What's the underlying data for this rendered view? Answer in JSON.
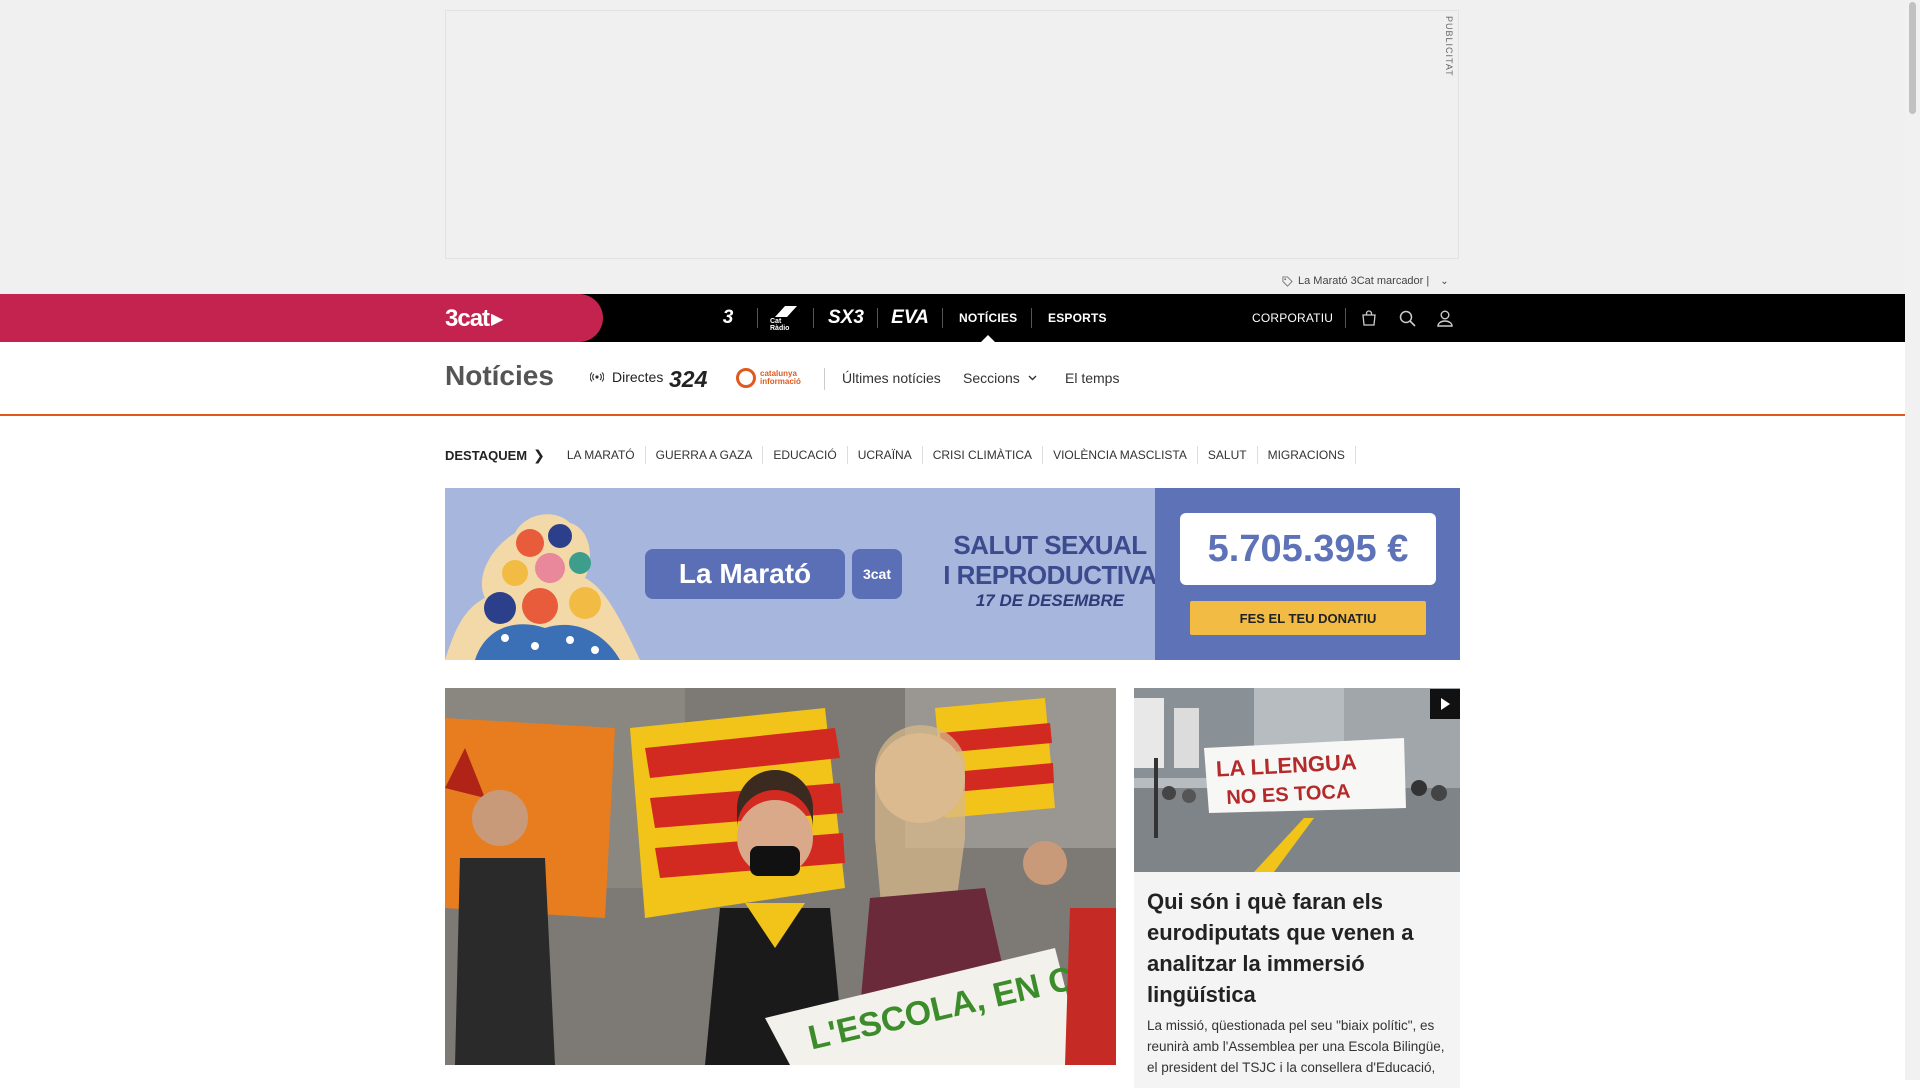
{
  "ad": {
    "label": "PUBLICITAT"
  },
  "marker": {
    "text": "La Marató 3Cat marcador |"
  },
  "topnav": {
    "brand": "3cat",
    "channels": [
      {
        "label": "3"
      },
      {
        "label": "Cat Ràdio"
      },
      {
        "label": "SX3"
      },
      {
        "label": "EVA"
      }
    ],
    "noticies": "NOTÍCIES",
    "esports": "ESPORTS",
    "corporatiu": "CORPORATIU"
  },
  "section": {
    "title": "Notícies",
    "directes": "Directes",
    "logo_324": "324",
    "logo_cat_line1": "catalunya",
    "logo_cat_line2": "informació",
    "links": [
      "Últimes notícies",
      "Seccions",
      "El temps"
    ]
  },
  "destaquem": {
    "label": "DESTAQUEM",
    "items": [
      "LA MARATÓ",
      "GUERRA A GAZA",
      "EDUCACIÓ",
      "UCRAÏNA",
      "CRISI CLIMÀTICA",
      "VIOLÈNCIA MASCLISTA",
      "SALUT",
      "MIGRACIONS"
    ]
  },
  "marato": {
    "logo": "La Marató",
    "logo_brand": "3cat",
    "tagline_1": "SALUT SEXUAL",
    "tagline_2": "I REPRODUCTIVA",
    "date": "17 DE DESEMBRE",
    "counter": "5.705.395 €",
    "donate": "FES EL TEU DONATIU"
  },
  "main_article": {
    "sign_text": "L'ESCOLA, EN CATALÀ"
  },
  "side_article": {
    "banner_text_1": "LA LLENGUA",
    "banner_text_2": "NO ES TOCA",
    "headline": "Qui són i què faran els eurodiputats que venen a analitzar la immersió lingüística",
    "summary": "La missió, qüestionada pel seu \"biaix polític\", es reunirà amb l'Assemblea per una Escola Bilingüe, el president del TSJC i la consellera d'Educació,"
  },
  "colors": {
    "brand": "#c4234f",
    "accent_orange": "#e05a1e",
    "marato_blue": "#5e72b8",
    "donate_yellow": "#f2bc44"
  }
}
